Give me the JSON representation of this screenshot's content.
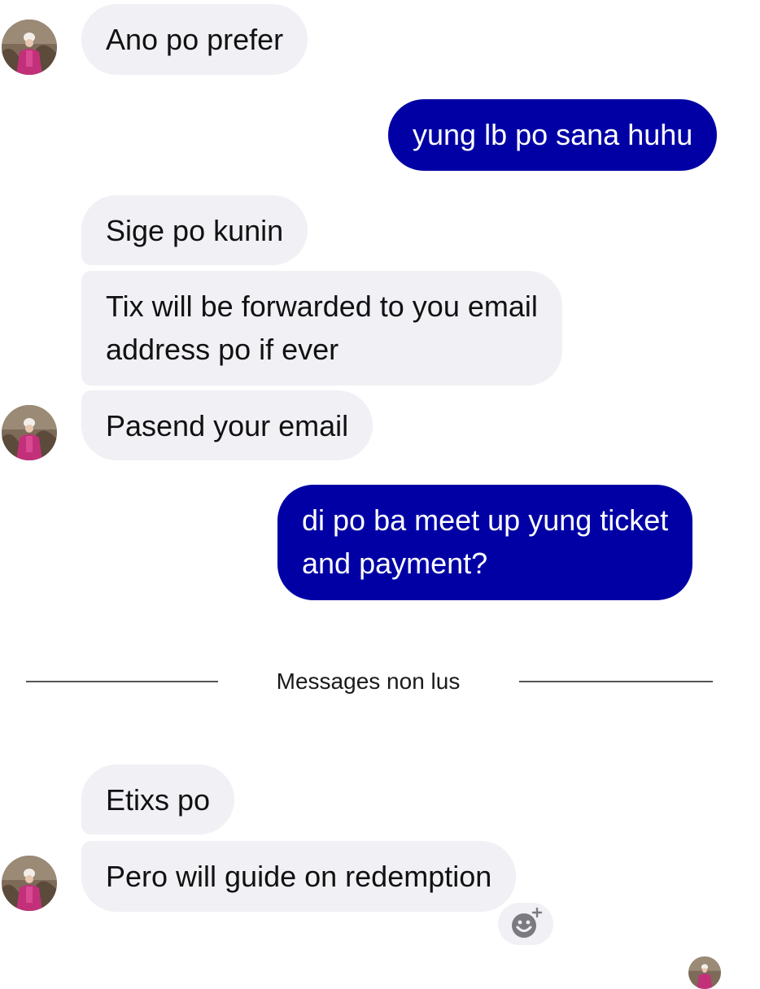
{
  "messages": [
    {
      "side": "received",
      "text": "Ano po prefer"
    },
    {
      "side": "sent",
      "text": "yung lb po sana huhu"
    },
    {
      "side": "received",
      "text": "Sige po kunin"
    },
    {
      "side": "received",
      "line1": "Tix will be forwarded to you email",
      "line2": "address po if ever"
    },
    {
      "side": "received",
      "text": "Pasend your email"
    },
    {
      "side": "sent",
      "line1": "di po ba meet up yung ticket",
      "line2": "and payment?"
    },
    {
      "side": "received",
      "text": "Etixs po"
    },
    {
      "side": "received",
      "text": "Pero will guide on redemption"
    }
  ],
  "divider": {
    "label": "Messages non lus"
  },
  "colors": {
    "sent_bubble": "#0000a5",
    "received_bubble": "#f0f0f5",
    "divider_line": "#555555"
  },
  "icons": {
    "contact_avatar": "avatar",
    "add_reaction": "smiley-plus-icon"
  }
}
